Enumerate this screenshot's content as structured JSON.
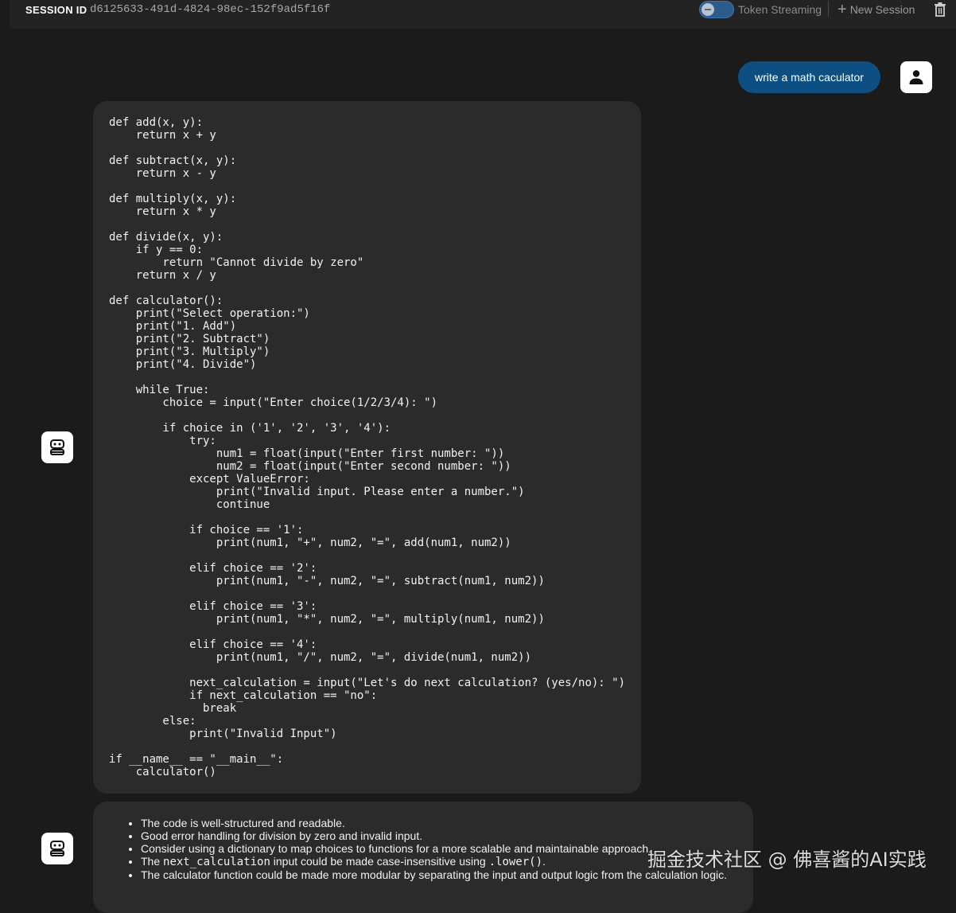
{
  "header": {
    "session_label": "SESSION ID",
    "session_id": "d6125633-491d-4824-98ec-152f9ad5f16f",
    "token_streaming_label": "Token Streaming",
    "token_streaming_enabled": true,
    "new_session_label": "New Session",
    "plus_icon": "+",
    "trash_icon": "trash-icon"
  },
  "conversation": {
    "user_message": "write a math caculator",
    "bot_code": "def add(x, y):\n    return x + y\n\ndef subtract(x, y):\n    return x - y\n\ndef multiply(x, y):\n    return x * y\n\ndef divide(x, y):\n    if y == 0:\n        return \"Cannot divide by zero\"\n    return x / y\n\ndef calculator():\n    print(\"Select operation:\")\n    print(\"1. Add\")\n    print(\"2. Subtract\")\n    print(\"3. Multiply\")\n    print(\"4. Divide\")\n\n    while True:\n        choice = input(\"Enter choice(1/2/3/4): \")\n\n        if choice in ('1', '2', '3', '4'):\n            try:\n                num1 = float(input(\"Enter first number: \"))\n                num2 = float(input(\"Enter second number: \"))\n            except ValueError:\n                print(\"Invalid input. Please enter a number.\")\n                continue\n\n            if choice == '1':\n                print(num1, \"+\", num2, \"=\", add(num1, num2))\n\n            elif choice == '2':\n                print(num1, \"-\", num2, \"=\", subtract(num1, num2))\n\n            elif choice == '3':\n                print(num1, \"*\", num2, \"=\", multiply(num1, num2))\n\n            elif choice == '4':\n                print(num1, \"/\", num2, \"=\", divide(num1, num2))\n\n            next_calculation = input(\"Let's do next calculation? (yes/no): \")\n            if next_calculation == \"no\":\n              break\n        else:\n            print(\"Invalid Input\")\n\nif __name__ == \"__main__\":\n    calculator()",
    "review": {
      "item1": "The code is well-structured and readable.",
      "item2": "Good error handling for division by zero and invalid input.",
      "item3": "Consider using a dictionary to map choices to functions for a more scalable and maintainable approach.",
      "item4_pre": "The ",
      "item4_code1": "next_calculation",
      "item4_mid": " input could be made case-insensitive using ",
      "item4_code2": ".lower()",
      "item4_post": ".",
      "item5": "The calculator function could be made more modular by separating the input and output logic from the calculation logic."
    }
  },
  "watermark": "掘金技术社区 @ 佛喜酱的AI实践",
  "colors": {
    "background": "#1b1b1b",
    "card": "#2b2b2b",
    "user_bubble": "#0d4f82",
    "toggle": "#2d5c8c"
  }
}
